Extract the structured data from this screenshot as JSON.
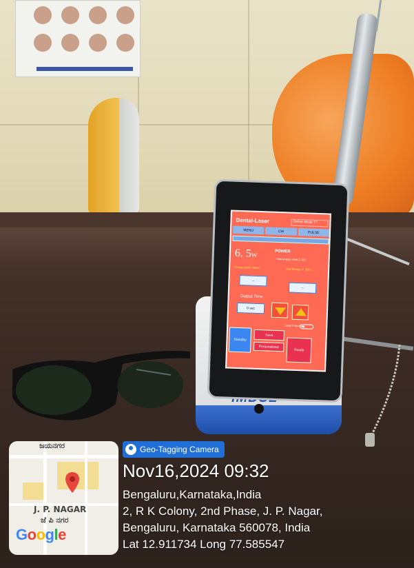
{
  "device_screen": {
    "title": "Dental-Laser",
    "badge": "Online  Mode  77",
    "tabs": [
      "MENU",
      "CW",
      "PULSE"
    ],
    "power_value": "6. 5",
    "power_unit": "W",
    "power_label": "POWER",
    "note_right": "Total energy used 0. 32J",
    "note_left": "Energy Used: 0000J",
    "note_right2": "Total Energy: 0. 32kJ",
    "box_left": "--",
    "box_right": "--",
    "output_label": "Output Time",
    "output_value": "0 sec",
    "laser_indicator": "Laser Indicator",
    "btn_standby": "Standby",
    "btn_save": "Save",
    "btn_personalized": "Personalized",
    "btn_ready": "Ready"
  },
  "dock_logo": "IMDSL",
  "geo": {
    "badge": "Geo-Tagging Camera",
    "datetime": "Nov16,2024 09:32",
    "line1": "Bengaluru,Karnataka,India",
    "line2": "2, R K Colony, 2nd Phase, J. P. Nagar,",
    "line3": "Bengaluru, Karnataka 560078, India",
    "line4": "Lat 12.911734 Long 77.585547"
  },
  "map": {
    "top_label": "ಜಯನಗರ",
    "area_label": "J. P. NAGAR",
    "area_label_local": "ಜೆ ಪಿ ನಗರ",
    "logo_letters": [
      "G",
      "o",
      "o",
      "g",
      "l",
      "e"
    ]
  },
  "colors": {
    "screen_bg": "#ff6a55",
    "badge_blue": "#1f6fd6",
    "pin_red": "#e8453c"
  }
}
